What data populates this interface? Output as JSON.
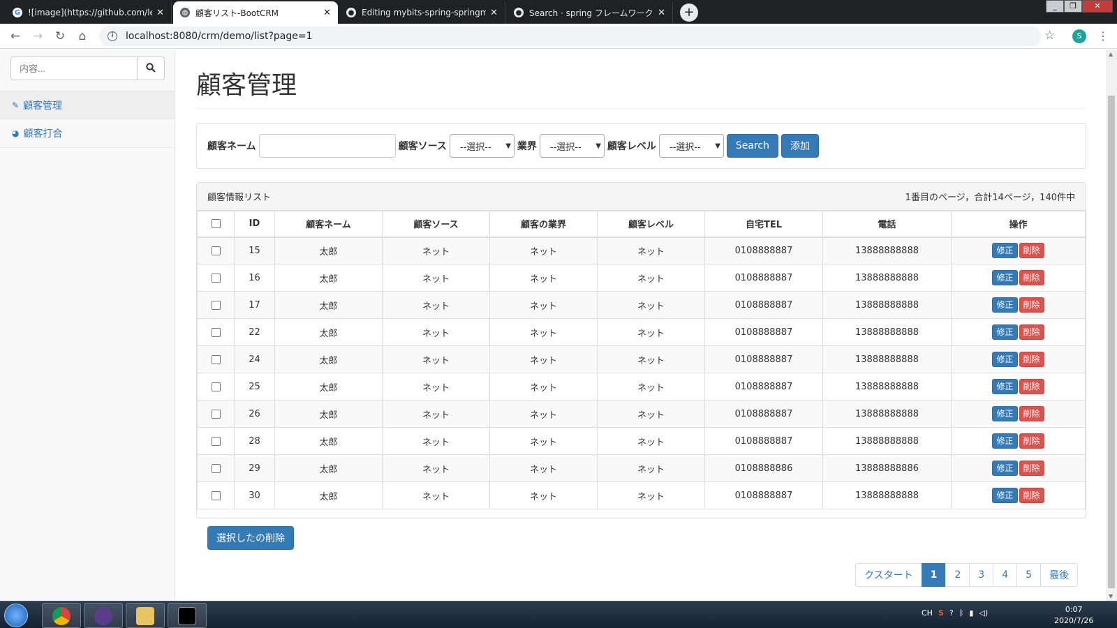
{
  "browser": {
    "tabs": [
      {
        "title": "![image](https://github.com/le",
        "favicon": "G"
      },
      {
        "title": "顧客リスト-BootCRM",
        "favicon": "globe"
      },
      {
        "title": "Editing mybits-spring-springm",
        "favicon": "github"
      },
      {
        "title": "Search · spring フレームワーク",
        "favicon": "github"
      }
    ],
    "url": "localhost:8080/crm/demo/list?page=1",
    "profile_initial": "S"
  },
  "sidebar": {
    "search_placeholder": "内容...",
    "items": [
      {
        "label": "顧客管理",
        "icon": "edit-icon"
      },
      {
        "label": "顧客打合",
        "icon": "dashboard-icon"
      }
    ]
  },
  "main": {
    "title": "顧客管理",
    "search": {
      "name_label": "顧客ネーム",
      "name_value": "",
      "source_label": "顧客ソース",
      "source_selected": "--選択--",
      "industry_label": "業界",
      "industry_selected": "--選択--",
      "level_label": "顧客レベル",
      "level_selected": "--選択--",
      "search_button": "Search",
      "add_button": "添加"
    },
    "list": {
      "heading": "顧客情報リスト",
      "page_info": "1番目のページ，合計14ページ，140件中",
      "columns": [
        "ID",
        "顧客ネーム",
        "顧客ソース",
        "顧客の業界",
        "顧客レベル",
        "自宅TEL",
        "電話",
        "操作"
      ],
      "edit_label": "修正",
      "delete_label": "削除",
      "rows": [
        {
          "id": "15",
          "name": "太郎",
          "source": "ネット",
          "industry": "ネット",
          "level": "ネット",
          "tel": "0108888887",
          "phone": "13888888888"
        },
        {
          "id": "16",
          "name": "太郎",
          "source": "ネット",
          "industry": "ネット",
          "level": "ネット",
          "tel": "0108888887",
          "phone": "13888888888"
        },
        {
          "id": "17",
          "name": "太郎",
          "source": "ネット",
          "industry": "ネット",
          "level": "ネット",
          "tel": "0108888887",
          "phone": "13888888888"
        },
        {
          "id": "22",
          "name": "太郎",
          "source": "ネット",
          "industry": "ネット",
          "level": "ネット",
          "tel": "0108888887",
          "phone": "13888888888"
        },
        {
          "id": "24",
          "name": "太郎",
          "source": "ネット",
          "industry": "ネット",
          "level": "ネット",
          "tel": "0108888887",
          "phone": "13888888888"
        },
        {
          "id": "25",
          "name": "太郎",
          "source": "ネット",
          "industry": "ネット",
          "level": "ネット",
          "tel": "0108888887",
          "phone": "13888888888"
        },
        {
          "id": "26",
          "name": "太郎",
          "source": "ネット",
          "industry": "ネット",
          "level": "ネット",
          "tel": "0108888887",
          "phone": "13888888888"
        },
        {
          "id": "28",
          "name": "太郎",
          "source": "ネット",
          "industry": "ネット",
          "level": "ネット",
          "tel": "0108888887",
          "phone": "13888888888"
        },
        {
          "id": "29",
          "name": "太郎",
          "source": "ネット",
          "industry": "ネット",
          "level": "ネット",
          "tel": "0108888886",
          "phone": "13888888886"
        },
        {
          "id": "30",
          "name": "太郎",
          "source": "ネット",
          "industry": "ネット",
          "level": "ネット",
          "tel": "0108888887",
          "phone": "13888888888"
        }
      ],
      "delete_selected": "選択したの削除"
    },
    "pagination": [
      "クスタート",
      "1",
      "2",
      "3",
      "4",
      "5",
      "最後"
    ],
    "current_page": "1"
  },
  "taskbar": {
    "ime": "CH",
    "time": "0:07",
    "date": "2020/7/26"
  },
  "colors": {
    "primary": "#337ab7",
    "danger": "#d9534f"
  }
}
